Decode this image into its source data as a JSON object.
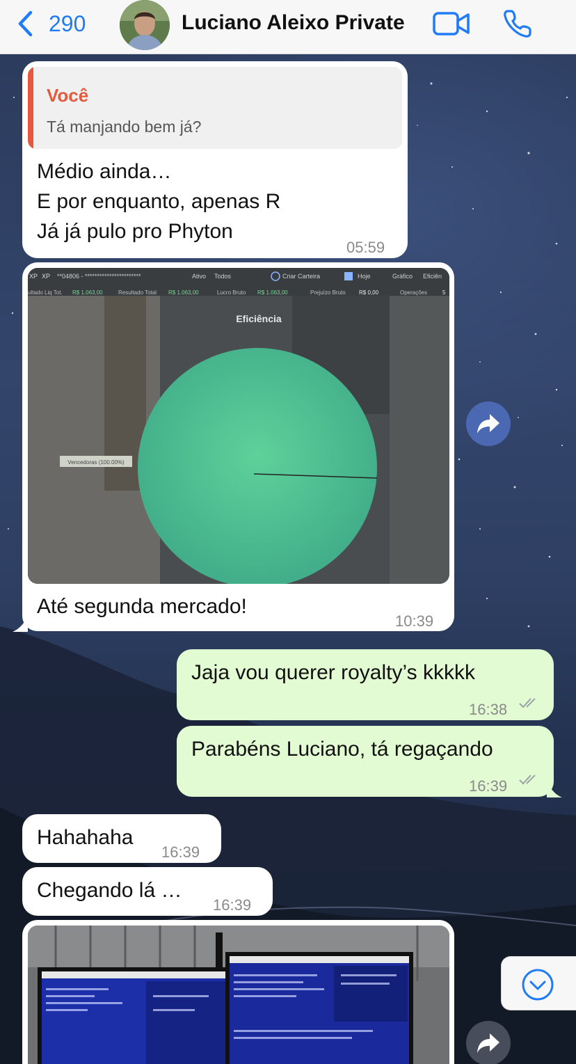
{
  "header": {
    "back_count": "290",
    "contact_name": "Luciano Aleixo Private",
    "icons": [
      "back-chevron-icon",
      "video-camera-icon",
      "phone-icon"
    ]
  },
  "messages": [
    {
      "direction": "in",
      "quote": {
        "author": "Você",
        "text": "Tá manjando bem já?"
      },
      "lines": [
        "Médio ainda…",
        "E por enquanto, apenas R",
        "Já já pulo pro Phyton"
      ],
      "time": "05:59"
    },
    {
      "direction": "in",
      "image": {
        "toolbar_text": [
          "XP",
          "**04806 - ***********************",
          "Ativo",
          "Todos",
          "Criar Carteira",
          "Hoje",
          "Gráfico",
          "Eficiên"
        ],
        "stats_text": [
          "ultado Liq Tot.",
          "R$ 1.063,00",
          "Resultado Total",
          "R$ 1.063,00",
          "Lucro Bruto",
          "R$ 1.063,00",
          "Prejuízo Bruto",
          "R$ 0,00",
          "Operações",
          "5"
        ],
        "chart_title": "Eficiência",
        "chart_legend": "Vencedoras (100.00%)"
      },
      "caption": "Até segunda mercado!",
      "time": "10:39"
    },
    {
      "direction": "out",
      "text": "Jaja vou querer royalty’s kkkkk",
      "time": "16:38"
    },
    {
      "direction": "out",
      "text": "Parabéns Luciano, tá regaçando",
      "time": "16:39"
    },
    {
      "direction": "in",
      "text": "Hahahaha",
      "time": "16:39"
    },
    {
      "direction": "in",
      "text": "Chegando lá …",
      "time": "16:39"
    },
    {
      "direction": "in",
      "image": {
        "description": ""
      }
    }
  ],
  "colors": {
    "accent_blue": "#1f7cf6",
    "quote_red": "#e35a3e",
    "outgoing_bubble": "#e3fbd3",
    "incoming_bubble": "#ffffff"
  }
}
